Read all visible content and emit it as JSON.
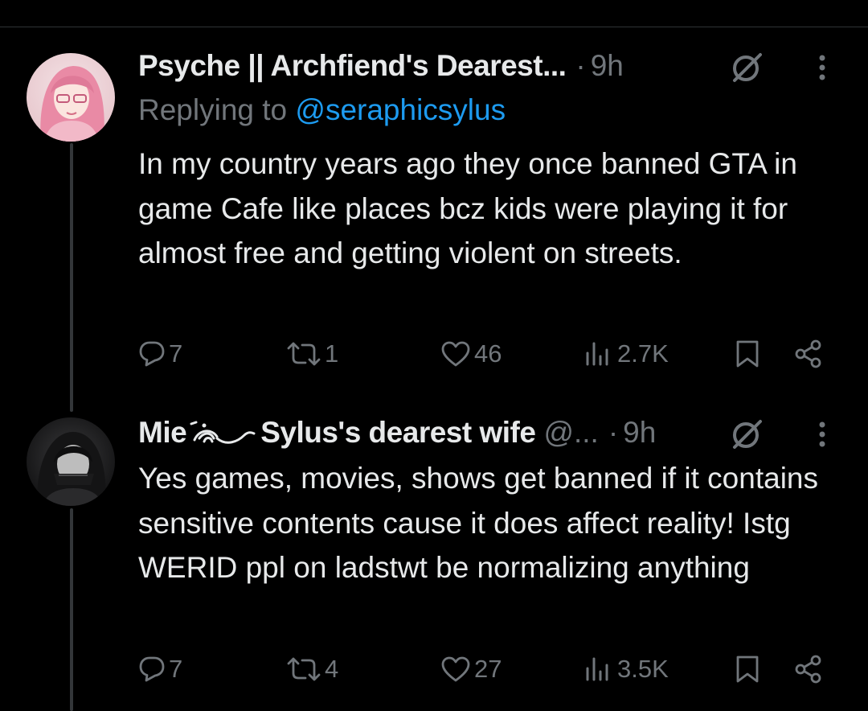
{
  "tweets": [
    {
      "display_name": "Psyche || Archfiend's Dearest...",
      "handle": "",
      "dot": "·",
      "time": "9h",
      "replying_prefix": "Replying to ",
      "replying_handle": "@seraphicsylus",
      "text": "In my country years ago they once banned GTA in game Cafe like places bcz kids were playing it for almost free and getting violent on streets.",
      "stats": {
        "replies": "7",
        "reposts": "1",
        "likes": "46",
        "views": "2.7K"
      }
    },
    {
      "display_name_prefix": "Mie",
      "display_name_suffix": "Sylus's dearest wife",
      "handle": "@...",
      "dot": "·",
      "time": "9h",
      "text": "Yes games, movies, shows get banned if it contains sensitive contents cause it does affect reality! Istg WERID ppl on ladstwt be normalizing anything",
      "stats": {
        "replies": "7",
        "reposts": "4",
        "likes": "27",
        "views": "3.5K"
      }
    }
  ],
  "icons": {
    "reply": "reply-icon",
    "repost": "repost-icon",
    "like": "heart-icon",
    "views": "analytics-icon",
    "bookmark": "bookmark-icon",
    "share": "share-icon",
    "more": "more-icon",
    "badge": "slashed-circle-icon"
  },
  "colors": {
    "background": "#000000",
    "text": "#e7e9ea",
    "secondary": "#71767b",
    "link": "#1d9bf0",
    "divider": "#2f3336"
  }
}
